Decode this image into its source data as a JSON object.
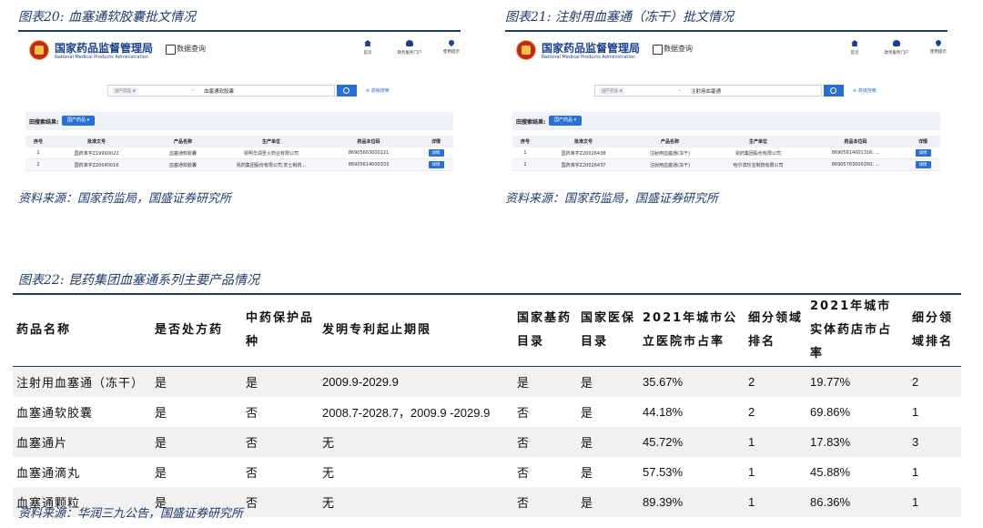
{
  "fig20": {
    "caption": "图表20:  血塞通软胶囊批文情况",
    "source": "资料来源：国家药监局，国盛证券研究所",
    "site": {
      "org_cn": "国家药品监督管理局",
      "org_en": "National Medical Products Administration",
      "data_query": "数据查询",
      "nav": [
        "首页",
        "政务服务门户",
        "使用提示"
      ]
    },
    "search": {
      "category": "国产药品 ⊗",
      "query": "血塞通软胶囊",
      "advanced": "≡ 高级搜索"
    },
    "results": {
      "label": "田搜索结果:",
      "tag": "国产药品  ▾"
    },
    "headers": [
      "序号",
      "批准文号",
      "产品名称",
      "生产单位",
      "药品本位码",
      "详情"
    ],
    "rows": [
      [
        "1",
        "国药准字Z19990022",
        "血塞通软胶囊",
        "昆明华润圣火药业有限公司",
        "86905603000221",
        "详情"
      ],
      [
        "2",
        "国药准字Z20040016",
        "血塞通软胶囊",
        "昆药集团股份有限公司,安士制药...",
        "86905614000333",
        "详情"
      ]
    ]
  },
  "fig21": {
    "caption": "图表21:  注射用血塞通（冻干）批文情况",
    "source": "资料来源：国家药监局，国盛证券研究所",
    "site": {
      "org_cn": "国家药品监督管理局",
      "org_en": "National Medical Products Administration",
      "data_query": "数据查询",
      "nav": [
        "首页",
        "政务服务门户",
        "使用提示"
      ]
    },
    "search": {
      "category": "国产药品 ⊗",
      "query": "注射用血塞通",
      "advanced": "≡ 高级搜索"
    },
    "results": {
      "label": "田搜索结果:",
      "tag": "国产药品  ▾"
    },
    "headers": [
      "序号",
      "批准文号",
      "产品名称",
      "生产单位",
      "药品本位码",
      "详情"
    ],
    "rows": [
      [
        "1",
        "国药准字Z20026438",
        "注射用血塞通(冻干)",
        "昆药集团股份有限公司",
        "86905614001316; ...",
        "详情"
      ],
      [
        "2",
        "国药准字Z20026437",
        "注射用血塞通(冻干)",
        "哈尔滨珍宝制药有限公司",
        "86905783000260; ...",
        "详情"
      ]
    ]
  },
  "fig22": {
    "caption": "图表22:  昆药集团血塞通系列主要产品情况",
    "source": "资料来源：华润三九公告，国盛证券研究所",
    "headers": [
      "药品名称",
      "是否处方药",
      "中药保护品种",
      "发明专利起止期限",
      "国家基药目录",
      "国家医保目录",
      "2021年城市公立医院市占率",
      "细分领域排名",
      "2021年城市实体药店市占率",
      "细分领域排名"
    ],
    "rows": [
      [
        "注射用血塞通（冻干）",
        "是",
        "是",
        "2009.9-2029.9",
        "是",
        "是",
        "35.67%",
        "2",
        "19.77%",
        "2"
      ],
      [
        "血塞通软胶囊",
        "是",
        "否",
        "2008.7-2028.7，2009.9 -2029.9",
        "否",
        "是",
        "44.18%",
        "2",
        "69.86%",
        "1"
      ],
      [
        "血塞通片",
        "是",
        "否",
        "无",
        "否",
        "是",
        "45.72%",
        "1",
        "17.83%",
        "3"
      ],
      [
        "血塞通滴丸",
        "是",
        "否",
        "无",
        "否",
        "是",
        "57.53%",
        "1",
        "45.88%",
        "1"
      ],
      [
        "血塞通颗粒",
        "是",
        "否",
        "无",
        "否",
        "是",
        "89.39%",
        "1",
        "86.36%",
        "1"
      ]
    ]
  }
}
